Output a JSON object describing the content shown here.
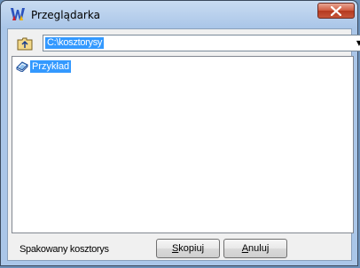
{
  "window": {
    "title": "Przeglądarka",
    "icon": "app-logo-icon",
    "close_icon": "close-icon"
  },
  "path_bar": {
    "up_icon": "up-folder-icon",
    "path_value": "C:\\kosztorysy",
    "dropdown_icon": "chevron-down-icon"
  },
  "tree": {
    "items": [
      {
        "label": "Przykład",
        "icon": "book-icon",
        "selected": true
      }
    ]
  },
  "footer": {
    "status_label": "Spakowany kosztorys",
    "copy_button": {
      "prefix": "S",
      "rest": "kopiuj"
    },
    "cancel_button": {
      "prefix": "A",
      "rest": "nuluj"
    }
  },
  "colors": {
    "selection": "#3399ff",
    "close_button": "#c9482b",
    "titlebar": "#c9dcf2"
  }
}
